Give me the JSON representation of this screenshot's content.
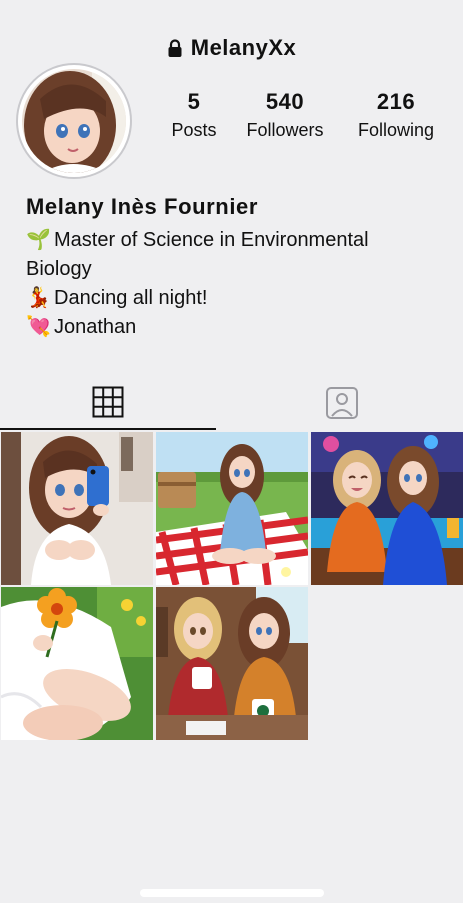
{
  "header": {
    "username": "MelanyXx",
    "lock_icon": "lock-icon"
  },
  "stats": {
    "posts": {
      "value": "5",
      "label": "Posts"
    },
    "followers": {
      "value": "540",
      "label": "Followers"
    },
    "following": {
      "value": "216",
      "label": "Following"
    }
  },
  "bio": {
    "name": "Melany Inès Fournier",
    "lines": [
      {
        "emoji": "🌱",
        "text": "Master of Science in Environmental"
      },
      {
        "emoji": "",
        "text": "Biology"
      },
      {
        "emoji": "💃",
        "text": "Dancing all night!"
      },
      {
        "emoji": "💘",
        "text": "Jonathan"
      }
    ]
  },
  "tabs": {
    "grid_icon": "grid-icon",
    "tagged_icon": "tagged-person-icon"
  },
  "colors": {
    "background": "#efeff1",
    "text": "#111111",
    "divider": "#c9c9cd"
  },
  "posts": [
    {
      "name": "post-selfie"
    },
    {
      "name": "post-picnic"
    },
    {
      "name": "post-party"
    },
    {
      "name": "post-flower"
    },
    {
      "name": "post-coffee"
    }
  ]
}
